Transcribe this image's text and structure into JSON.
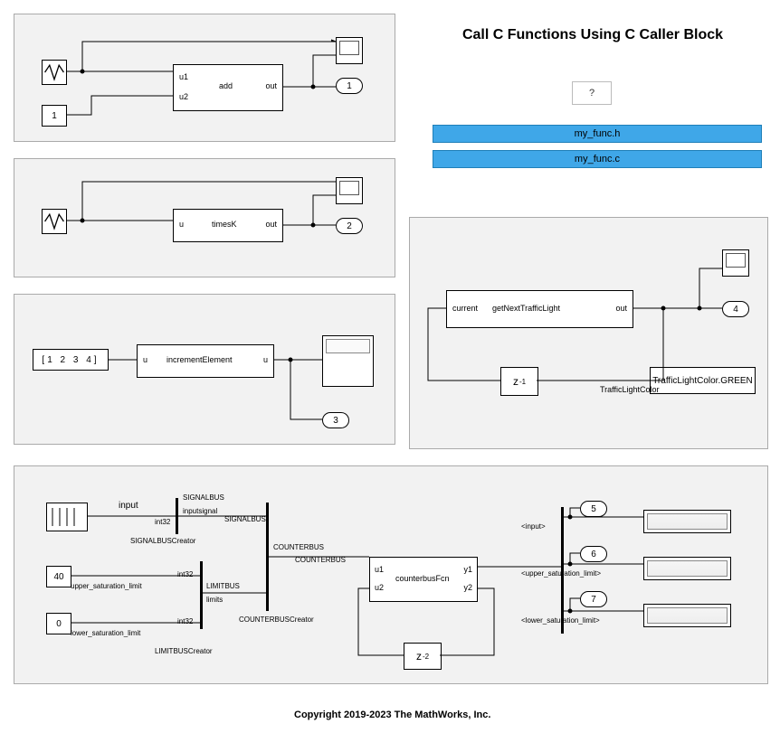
{
  "title": "Call C Functions Using C Caller Block",
  "help_btn": "?",
  "files": {
    "header": "my_func.h",
    "source": "my_func.c"
  },
  "panel1": {
    "block_fn": "add",
    "port_u1": "u1",
    "port_u2": "u2",
    "port_out": "out",
    "const_val": "1",
    "outport": "1"
  },
  "panel2": {
    "block_fn": "timesK",
    "port_u": "u",
    "port_out": "out",
    "outport": "2"
  },
  "panel3": {
    "block_fn": "incrementElement",
    "port_u_in": "u",
    "port_u_out": "u",
    "const_val": "[1 2 3 4]",
    "outport": "3"
  },
  "panel4": {
    "block_fn": "getNextTrafficLight",
    "port_current": "current",
    "port_out": "out",
    "unit_delay": "z",
    "unit_delay_exp": "-1",
    "sig_label": "TrafficLightColor",
    "enum_value": "TrafficLightColor.GREEN",
    "outport": "4"
  },
  "panel5": {
    "inputs": {
      "input_sig": "input",
      "int32": "int32",
      "upper_sat_val": "40",
      "upper_sat_label": "upper_saturation_limit",
      "lower_sat_val": "0",
      "lower_sat_label": "lower_saturation_limit"
    },
    "bus_labels": {
      "signalbus1": "SIGNALBUS",
      "inputsignal": "inputsignal",
      "signalbus2": "SIGNALBUS",
      "signalbuscreator": "SIGNALBUSCreator",
      "limitbus1": "LIMITBUS",
      "limits": "limits",
      "limitbuscreator": "LIMITBUSCreator",
      "counterbus1": "COUNTERBUS",
      "counterbus2": "COUNTERBUS",
      "counterbuscreator": "COUNTERBUSCreator"
    },
    "block": {
      "fn": "counterbusFcn",
      "u1": "u1",
      "u2": "u2",
      "y1": "y1",
      "y2": "y2"
    },
    "outbus": {
      "sig_input": "<input>",
      "sig_upper": "<upper_saturation_limit>",
      "sig_lower": "<lower_saturation_limit>"
    },
    "outports": {
      "p5": "5",
      "p6": "6",
      "p7": "7"
    },
    "unit_delay": "z",
    "unit_delay_exp": "-2"
  },
  "copyright": "Copyright 2019-2023 The MathWorks, Inc."
}
